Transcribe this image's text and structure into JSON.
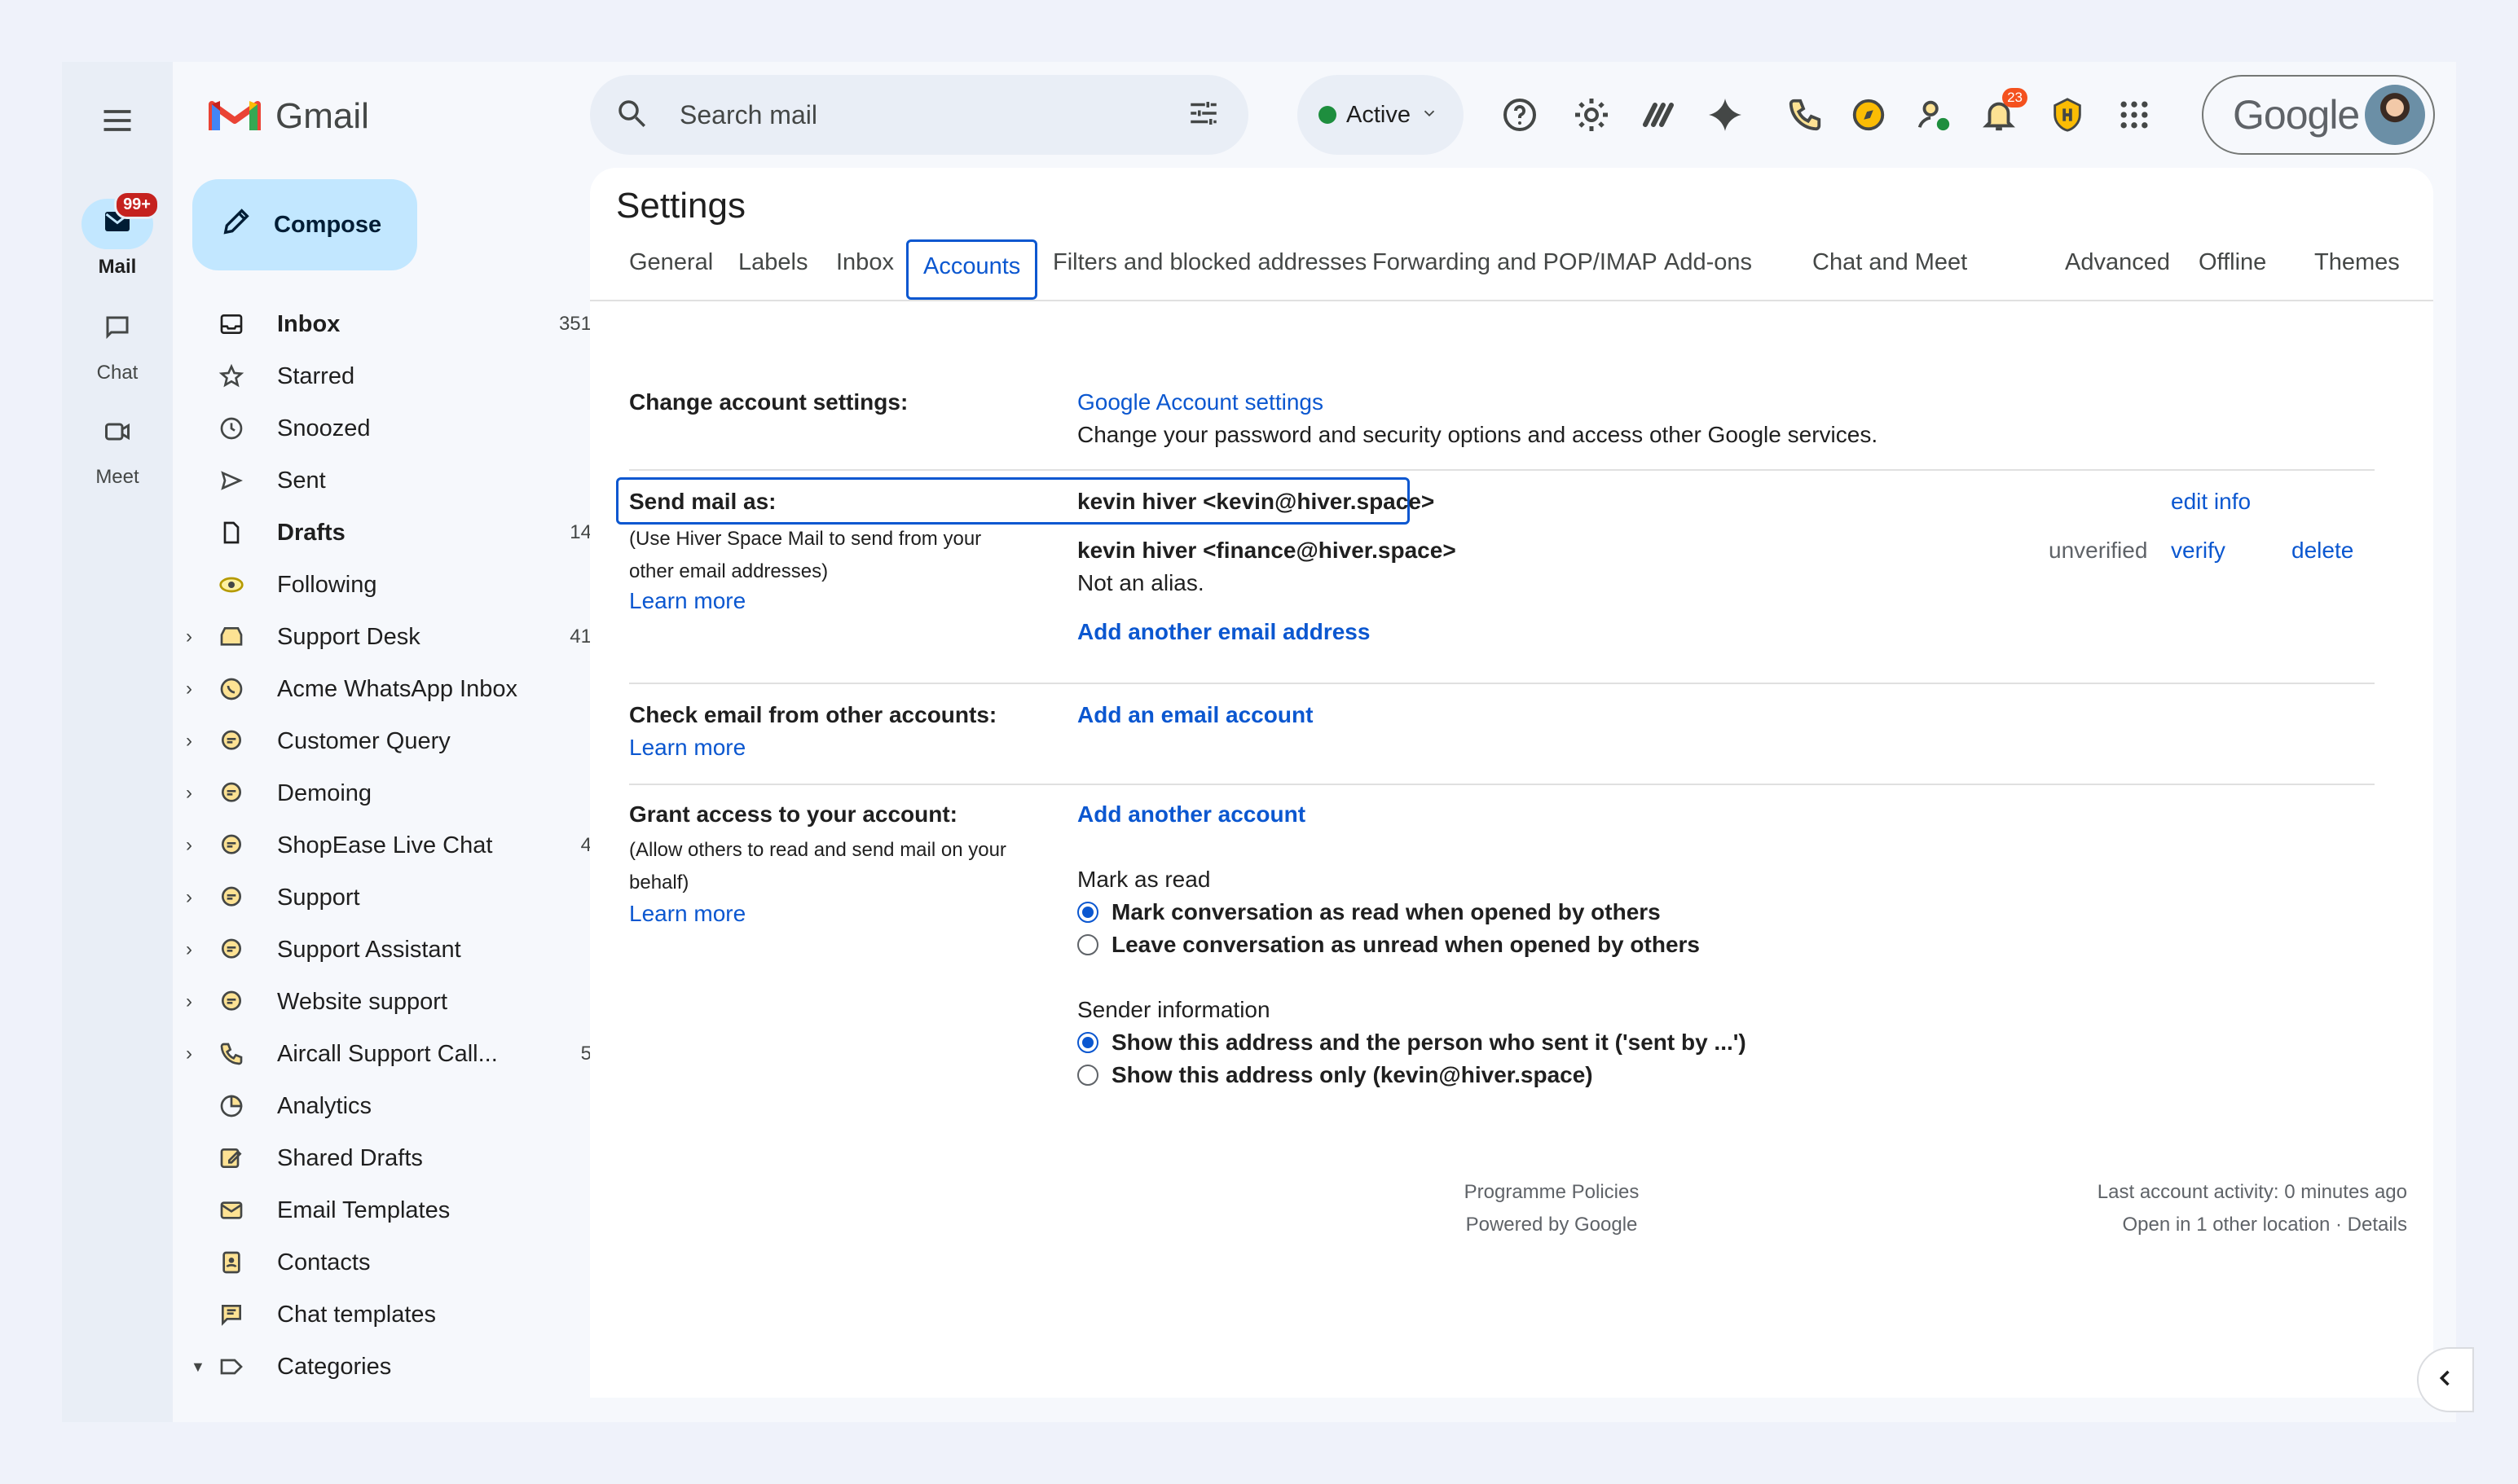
{
  "rail": {
    "mail_label": "Mail",
    "mail_badge": "99+",
    "chat_label": "Chat",
    "meet_label": "Meet"
  },
  "brand": {
    "name": "Gmail"
  },
  "compose": {
    "label": "Compose"
  },
  "nav": {
    "items": [
      {
        "label": "Inbox",
        "count": "351"
      },
      {
        "label": "Starred",
        "count": ""
      },
      {
        "label": "Snoozed",
        "count": ""
      },
      {
        "label": "Sent",
        "count": ""
      },
      {
        "label": "Drafts",
        "count": "14"
      },
      {
        "label": "Following",
        "count": ""
      },
      {
        "label": "Support Desk",
        "count": "41"
      },
      {
        "label": "Acme WhatsApp Inbox",
        "count": ""
      },
      {
        "label": "Customer Query",
        "count": ""
      },
      {
        "label": "Demoing",
        "count": ""
      },
      {
        "label": "ShopEase Live Chat",
        "count": "4"
      },
      {
        "label": "Support",
        "count": ""
      },
      {
        "label": "Support Assistant",
        "count": ""
      },
      {
        "label": "Website support",
        "count": ""
      },
      {
        "label": "Aircall Support Call...",
        "count": "5"
      },
      {
        "label": "Analytics",
        "count": ""
      },
      {
        "label": "Shared Drafts",
        "count": ""
      },
      {
        "label": "Email Templates",
        "count": ""
      },
      {
        "label": "Contacts",
        "count": ""
      },
      {
        "label": "Chat templates",
        "count": ""
      },
      {
        "label": "Categories",
        "count": ""
      }
    ]
  },
  "topbar": {
    "search_placeholder": "Search mail",
    "status_label": "Active",
    "notification_count": "23",
    "account_brand": "Google"
  },
  "settings": {
    "title": "Settings",
    "tabs": [
      "General",
      "Labels",
      "Inbox",
      "Accounts",
      "Filters and blocked addresses",
      "Forwarding and POP/IMAP",
      "Add-ons",
      "Chat and Meet",
      "Advanced",
      "Offline",
      "Themes"
    ],
    "change_account": {
      "label": "Change account settings:",
      "link": "Google Account settings",
      "desc": "Change your password and security options and access other Google services."
    },
    "send_mail_as": {
      "label": "Send mail as:",
      "note": "(Use Hiver Space Mail to send from your other email addresses)",
      "learn_more": "Learn more",
      "address1": "kevin hiver <kevin@hiver.space>",
      "edit_info": "edit info",
      "address2": "kevin hiver <finance@hiver.space>",
      "unverified": "unverified",
      "verify": "verify",
      "delete": "delete",
      "not_alias": "Not an alias.",
      "add_another": "Add another email address"
    },
    "check_email": {
      "label": "Check email from other accounts:",
      "learn_more": "Learn more",
      "add_account": "Add an email account"
    },
    "grant_access": {
      "label": "Grant access to your account:",
      "note": "(Allow others to read and send mail on your behalf)",
      "learn_more": "Learn more",
      "add_another": "Add another account",
      "mark_as_read_title": "Mark as read",
      "mark_option1": "Mark conversation as read when opened by others",
      "mark_option2": "Leave conversation as unread when opened by others",
      "sender_info_title": "Sender information",
      "sender_option1": "Show this address and the person who sent it ('sent by ...')",
      "sender_option2": "Show this address only (kevin@hiver.space)"
    },
    "footer": {
      "policies": "Programme Policies",
      "powered": "Powered by Google",
      "activity": "Last account activity: 0 minutes ago",
      "other_location": "Open in 1 other location · Details"
    }
  },
  "colors": {
    "accent": "#0b57d0",
    "compose_bg": "#c2e7ff",
    "badge": "#c5221f"
  }
}
